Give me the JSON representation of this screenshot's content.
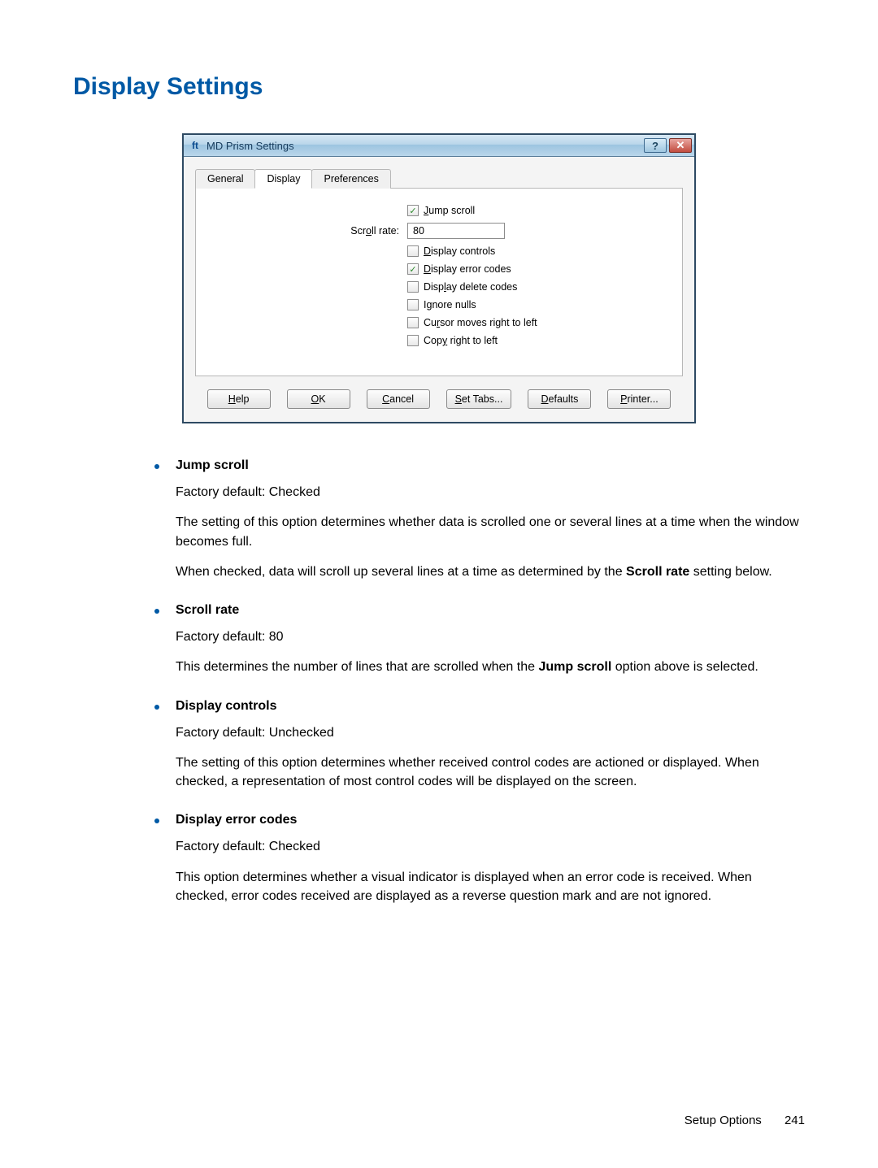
{
  "heading": "Display Settings",
  "dialog": {
    "icon_name": "app-icon",
    "title": "MD Prism Settings",
    "help_glyph": "?",
    "close_glyph": "✕",
    "tabs": [
      {
        "label": "General",
        "active": false
      },
      {
        "label": "Display",
        "active": true
      },
      {
        "label": "Preferences",
        "active": false
      }
    ],
    "scroll_rate_label": "Scroll rate:",
    "scroll_rate_value": "80",
    "checkboxes": [
      {
        "name": "jump-scroll",
        "checked": true,
        "u": "J",
        "rest": "ump scroll"
      },
      {
        "name": "display-controls",
        "checked": false,
        "u": "D",
        "rest": "isplay controls"
      },
      {
        "name": "display-error-codes",
        "checked": true,
        "u": "D",
        "rest": "isplay error codes"
      },
      {
        "name": "display-delete-codes",
        "checked": false,
        "u": "l",
        "pre": "Disp",
        "rest": "ay delete codes"
      },
      {
        "name": "ignore-nulls",
        "checked": false,
        "u": "g",
        "pre": "I",
        "rest": "nore nulls"
      },
      {
        "name": "cursor-rtl",
        "checked": false,
        "u": "r",
        "pre": "Cu",
        "rest": "sor moves right to left"
      },
      {
        "name": "copy-rtl",
        "checked": false,
        "u": "y",
        "pre": "Cop",
        "rest": " right to left"
      }
    ],
    "buttons": [
      {
        "name": "help",
        "u": "H",
        "rest": "elp"
      },
      {
        "name": "ok",
        "u": "O",
        "rest": "K"
      },
      {
        "name": "cancel",
        "u": "C",
        "rest": "ancel"
      },
      {
        "name": "set-tabs",
        "u": "S",
        "rest": "et Tabs..."
      },
      {
        "name": "defaults",
        "u": "D",
        "rest": "efaults"
      },
      {
        "name": "printer",
        "u": "P",
        "rest": "rinter..."
      }
    ]
  },
  "descriptions": [
    {
      "title": "Jump scroll",
      "default": "Factory default: Checked",
      "paras": [
        "The setting of this option determines whether data is scrolled one or several lines at a time when the window becomes full.",
        "When checked, data will scroll up several lines at a time as determined by the <b>Scroll rate</b> setting below."
      ]
    },
    {
      "title": "Scroll rate",
      "default": "Factory default: 80",
      "paras": [
        "This determines the number of lines that are scrolled when the <b>Jump scroll</b> option above is selected."
      ]
    },
    {
      "title": "Display controls",
      "default": "Factory default: Unchecked",
      "paras": [
        "The setting of this option determines whether received control codes are actioned or displayed. When checked, a representation of most control codes will be displayed on the screen."
      ]
    },
    {
      "title": "Display error codes",
      "default": "Factory default: Checked",
      "paras": [
        "This option determines whether a visual indicator is displayed when an error code is received. When checked, error codes received are displayed as a reverse question mark and are not ignored."
      ]
    }
  ],
  "footer": {
    "section": "Setup Options",
    "page": "241"
  }
}
